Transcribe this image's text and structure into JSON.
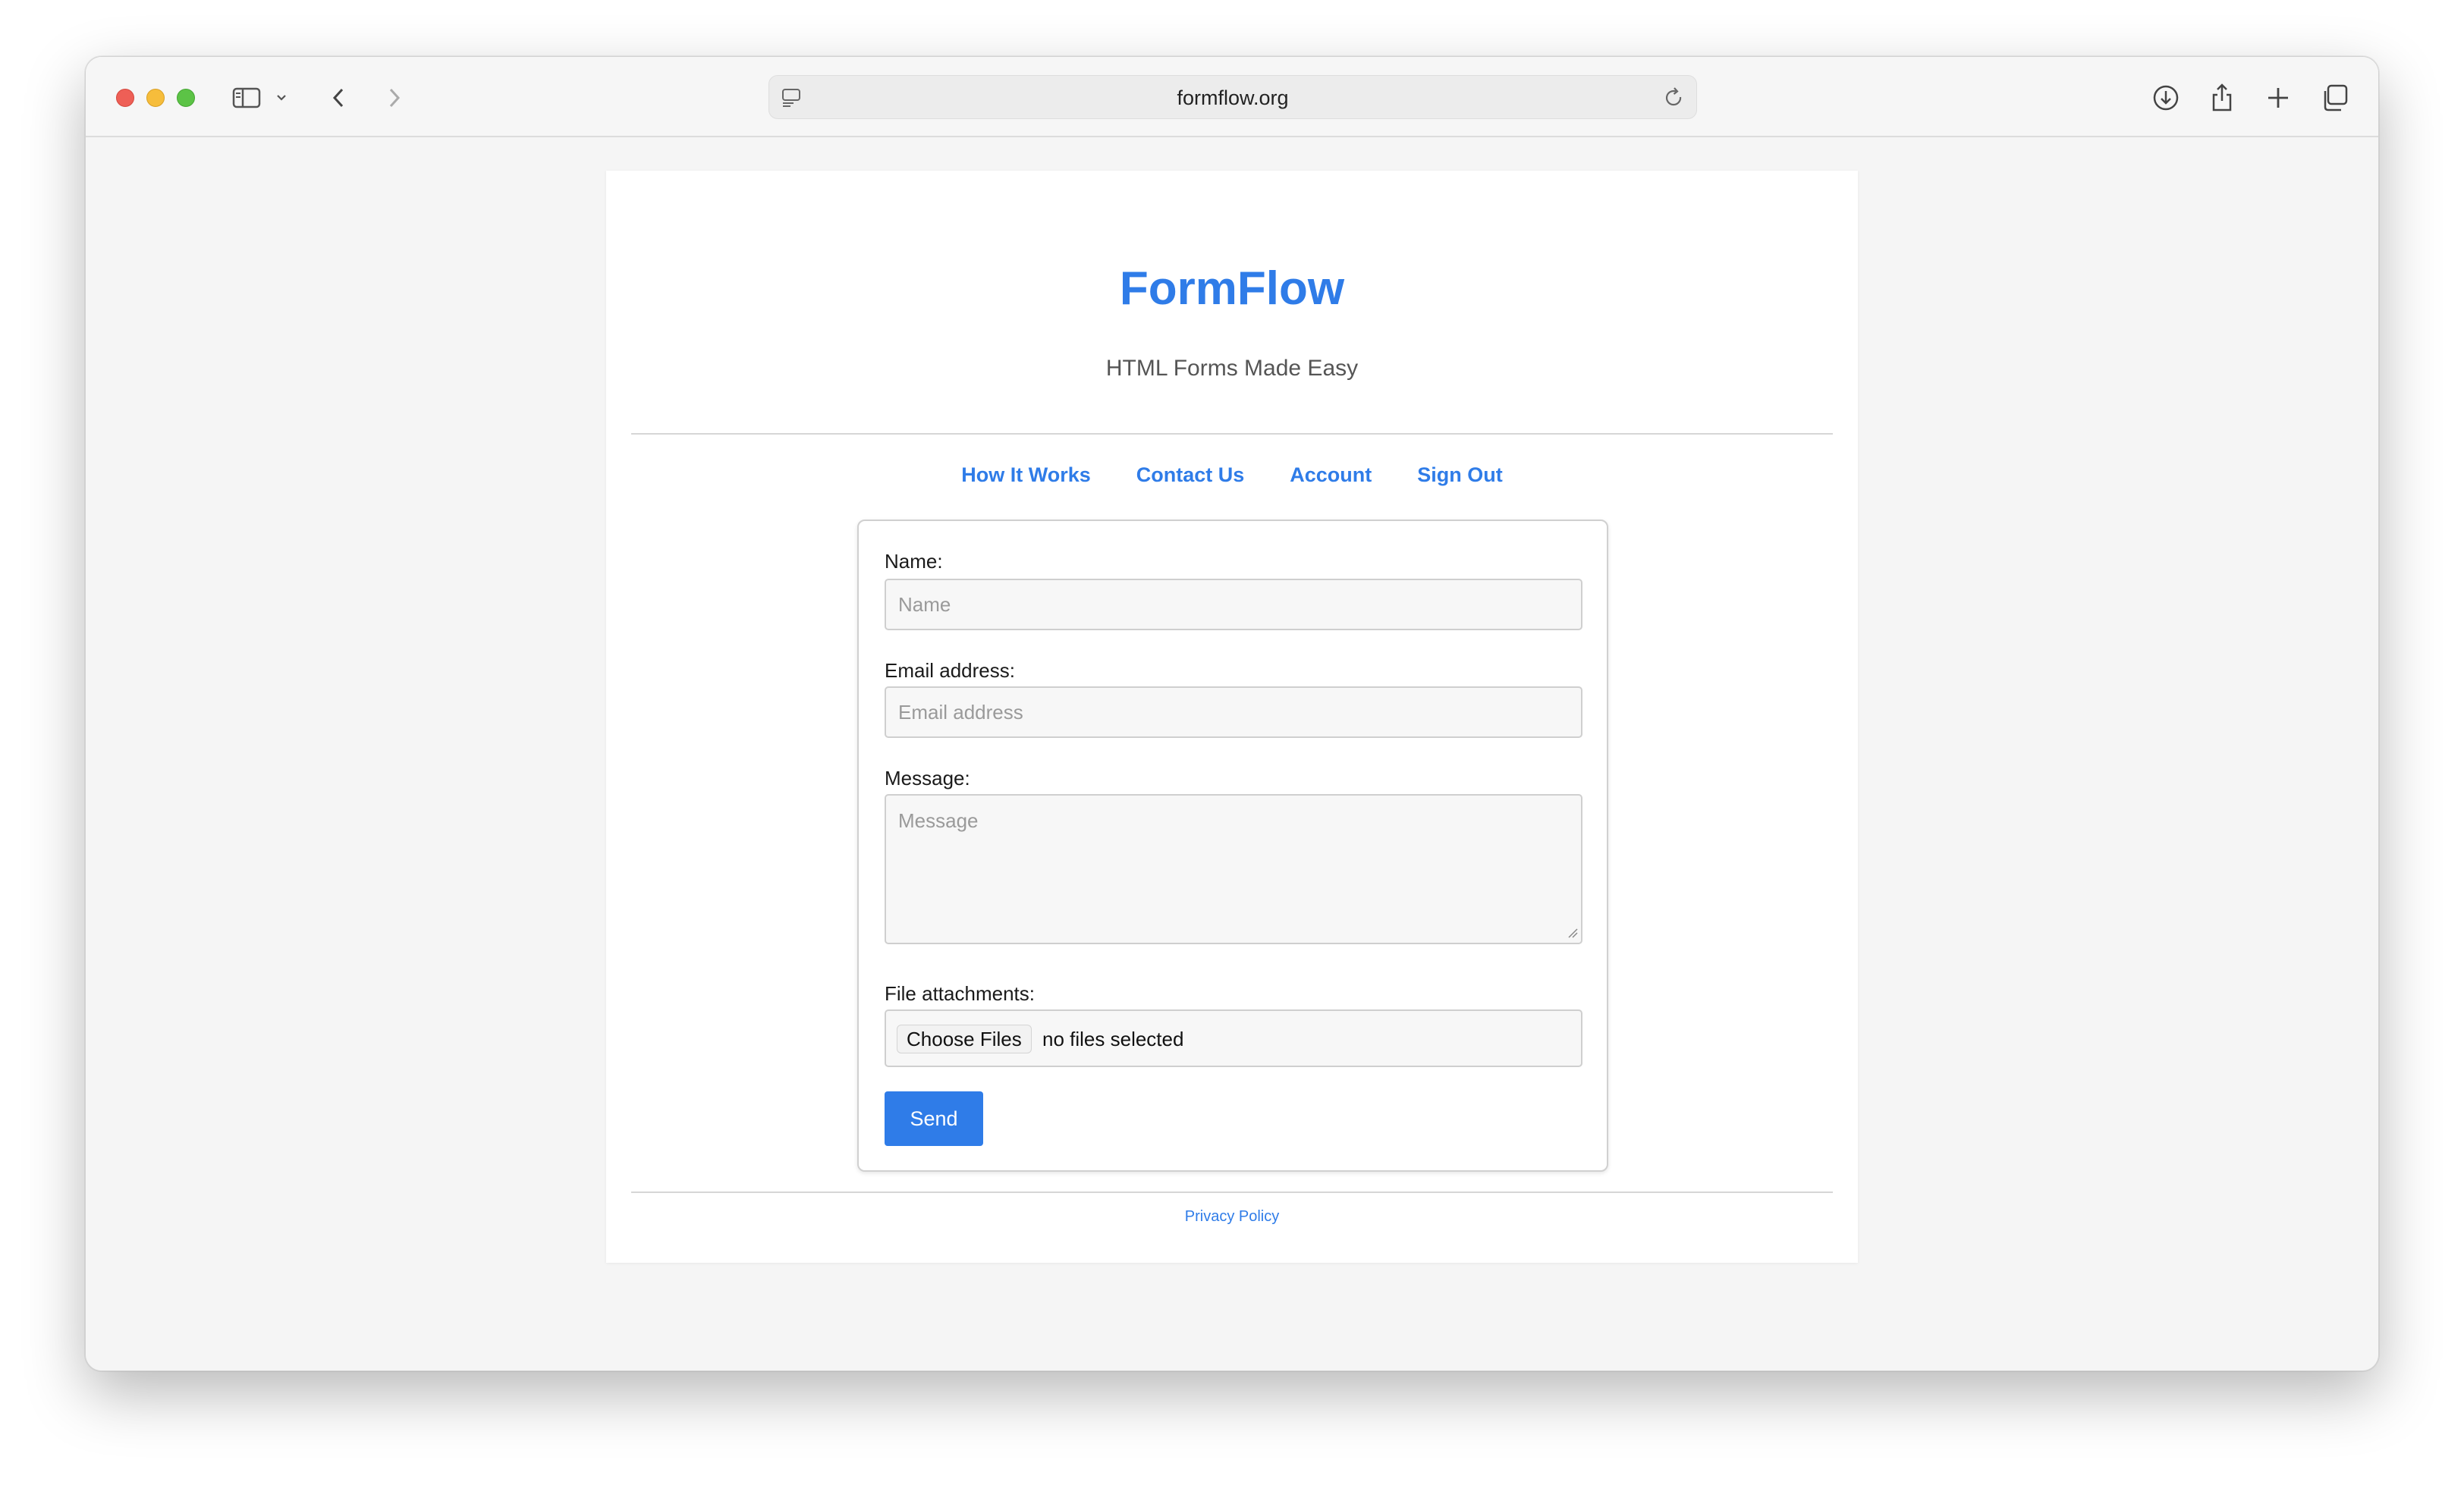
{
  "browser": {
    "url": "formflow.org"
  },
  "site": {
    "brand": "FormFlow",
    "tagline": "HTML Forms Made Easy"
  },
  "nav": {
    "items": [
      {
        "label": "How It Works"
      },
      {
        "label": "Contact Us"
      },
      {
        "label": "Account"
      },
      {
        "label": "Sign Out"
      }
    ]
  },
  "form": {
    "name_label": "Name:",
    "name_placeholder": "Name",
    "email_label": "Email address:",
    "email_placeholder": "Email address",
    "message_label": "Message:",
    "message_placeholder": "Message",
    "file_label": "File attachments:",
    "file_button": "Choose Files",
    "file_status": "no files selected",
    "submit_label": "Send"
  },
  "footer": {
    "privacy_link": "Privacy Policy"
  },
  "colors": {
    "accent": "#2f7ce8",
    "page_bg": "#f5f5f5"
  }
}
